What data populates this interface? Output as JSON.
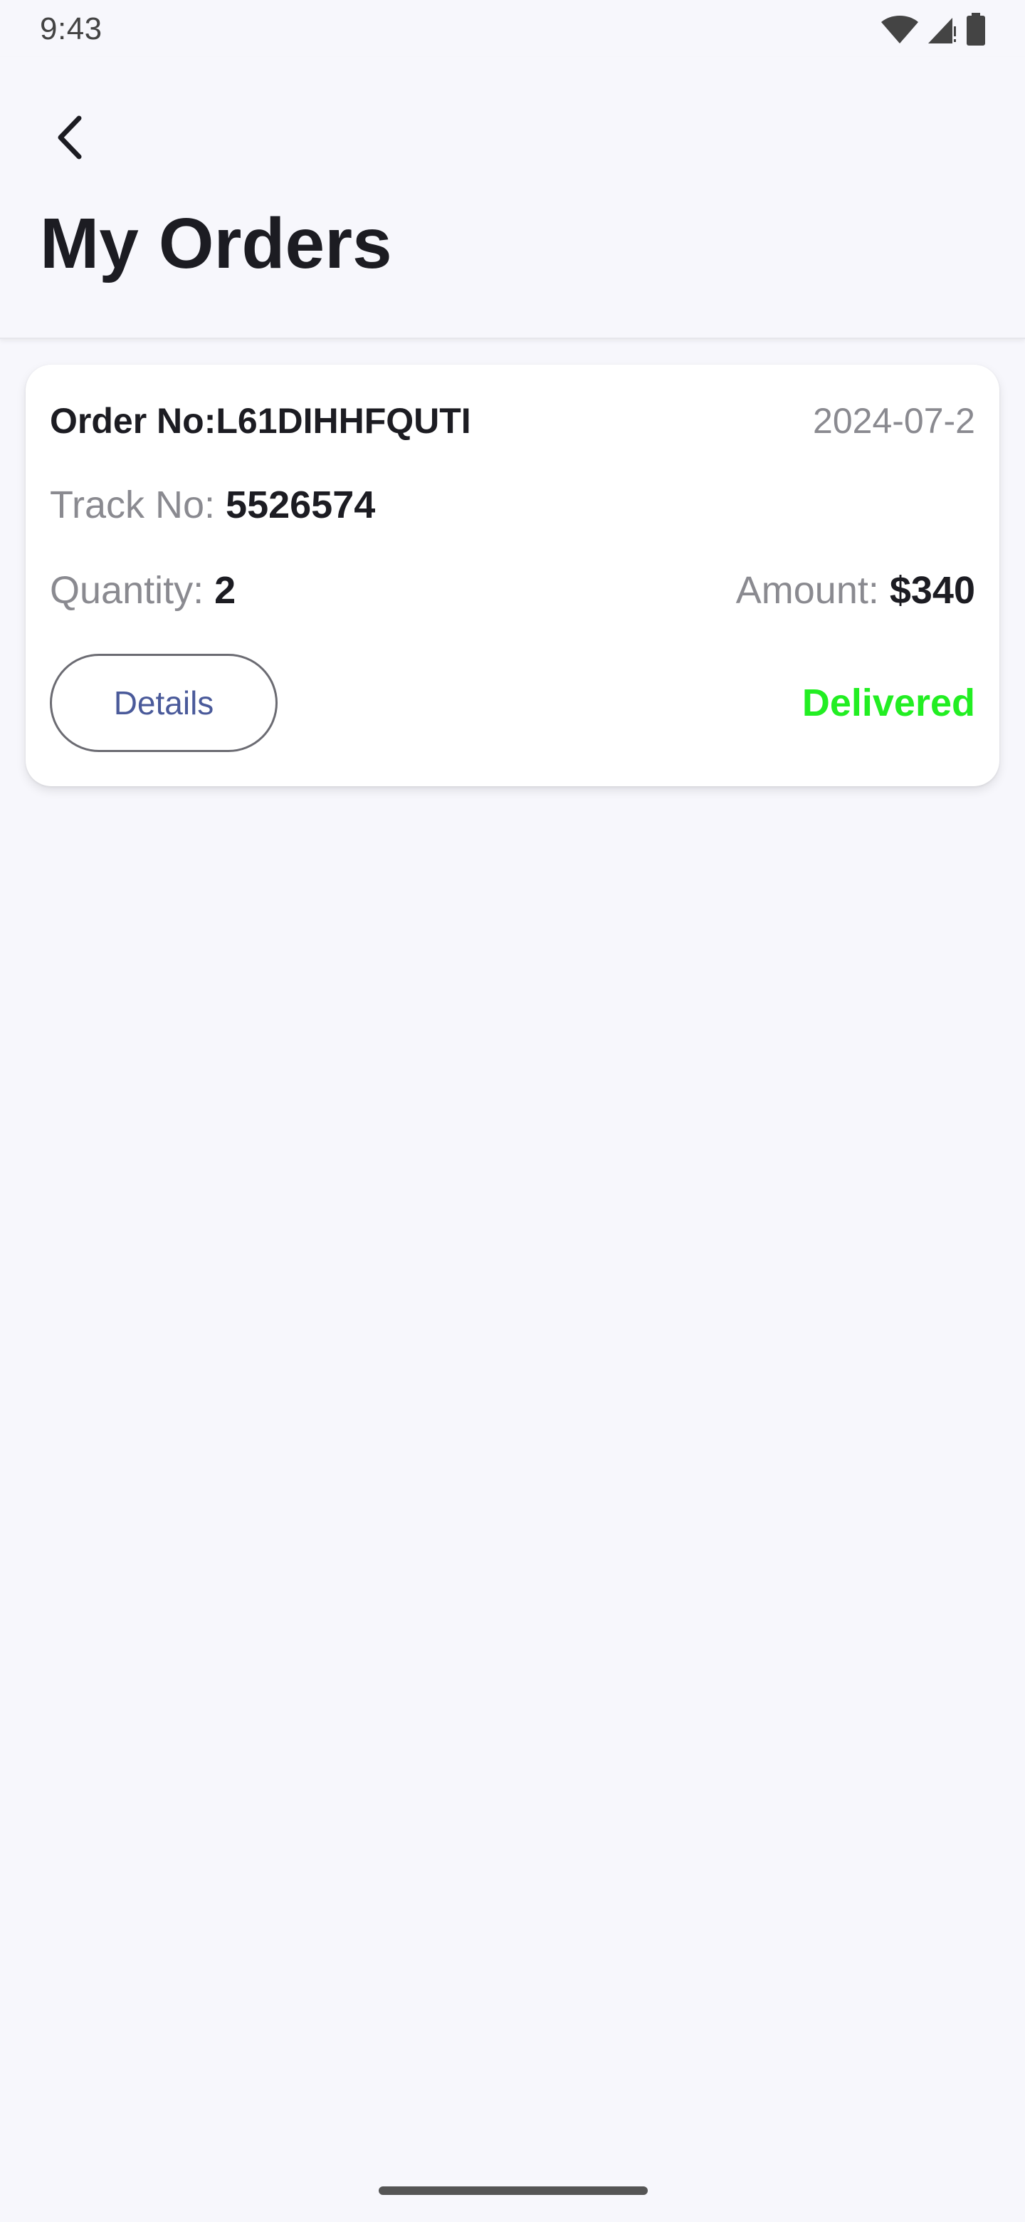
{
  "status_bar": {
    "time": "9:43",
    "icons": [
      "wifi-icon",
      "signal-icon",
      "battery-icon"
    ]
  },
  "header": {
    "back_icon": "chevron-left-icon",
    "title": "My Orders"
  },
  "orders": [
    {
      "order_no": "Order No:L61DIHHFQUTI",
      "date": "2024-07-2",
      "track_label": "Track No: ",
      "track_value": "5526574",
      "quantity_label": "Quantity: ",
      "quantity_value": "2",
      "amount_label": "Amount: ",
      "amount_value": "$340",
      "details_label": "Details",
      "status": "Delivered",
      "status_color": "#22ee22"
    }
  ],
  "colors": {
    "background": "#f7f7fc",
    "card": "#ffffff",
    "text_primary": "#1c1c22",
    "text_secondary": "#8a8a90",
    "details_text": "#4a5a9a",
    "delivered": "#22ee22"
  }
}
